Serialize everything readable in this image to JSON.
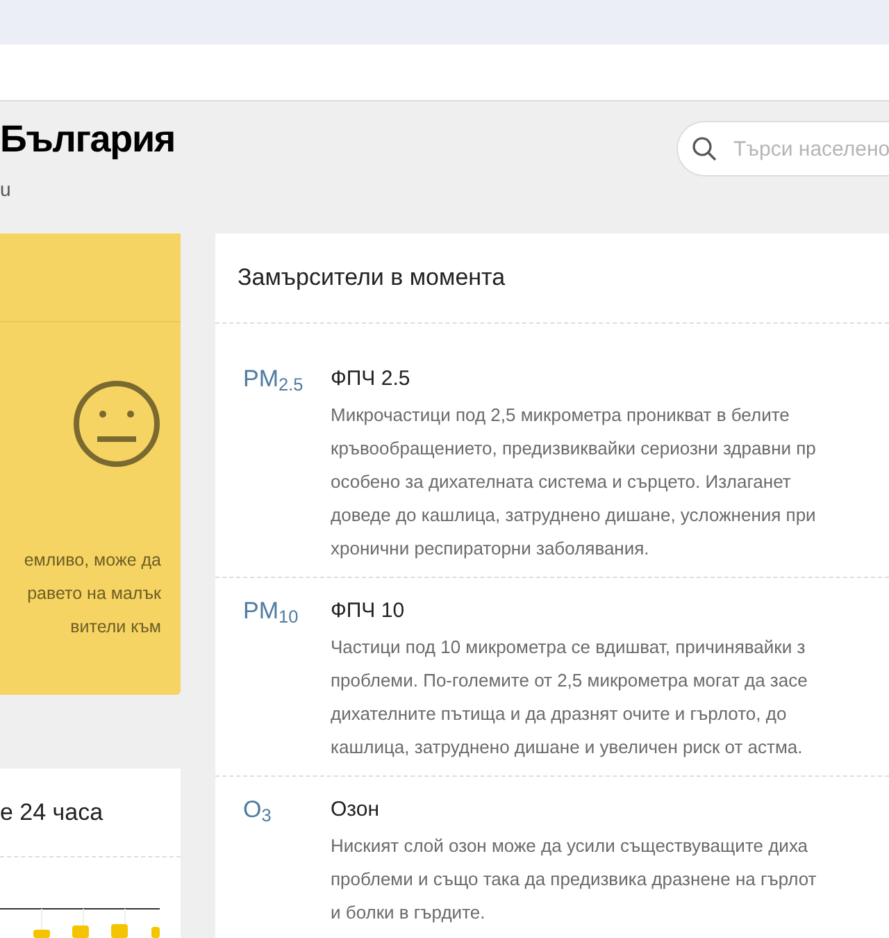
{
  "header": {
    "title": "България",
    "subtitle": "u",
    "search": {
      "placeholder": "Търси населено"
    }
  },
  "status_card": {
    "lines": [
      "емливо, може да",
      "равето на малък",
      "вители към"
    ]
  },
  "history_card": {
    "title": "е 24 часа"
  },
  "pollutants_card": {
    "title": "Замърсители в момента",
    "items": [
      {
        "symbol": "PM$_{2.5}$",
        "name": "ФПЧ 2.5",
        "description": "Микрочастици под 2,5 микрометра проникват в белите\nкръвообращението, предизвиквайки сериозни здравни пр\nособено за дихателната система и сърцето. Излаганет\nдоведе до кашлица, затруднено дишане, усложнения при\nхронични респираторни заболявания."
      },
      {
        "symbol": "PM$_{10}$",
        "name": "ФПЧ 10",
        "description": "Частици под 10 микрометра се вдишват, причинявайки з\nпроблеми. По-големите от 2,5 микрометра могат да засе\nдихателните пътища и да дразнят очите и гърлото, до\nкашлица, затруднено дишане и увеличен риск от астма."
      },
      {
        "symbol": "O$_{3}$",
        "name": "Озон",
        "description": "Ниският слой озон може да усили съществуващите диха\nпроблеми и също така да предизвика дразнене на гърлот\nи болки в гърдите."
      }
    ]
  }
}
